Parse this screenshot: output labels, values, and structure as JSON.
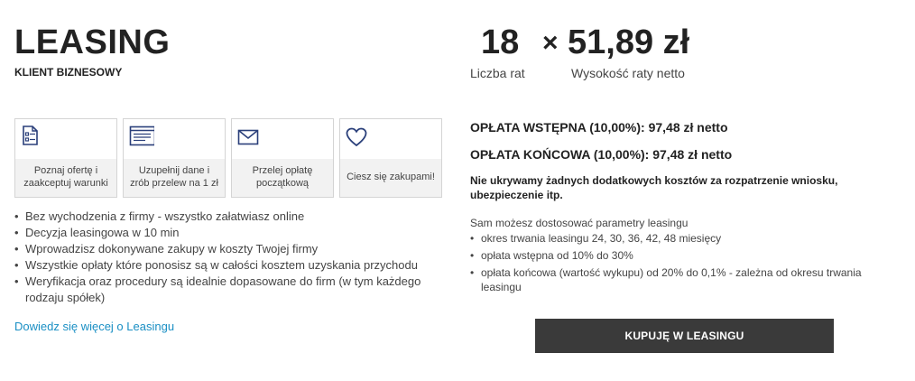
{
  "header": {
    "title": "LEASING",
    "subtitle": "KLIENT BIZNESOWY"
  },
  "steps": [
    {
      "icon": "document-list-icon",
      "label": "Poznaj ofertę i zaakceptuj warunki"
    },
    {
      "icon": "form-icon",
      "label": "Uzupełnij dane i zrób przelew na 1 zł"
    },
    {
      "icon": "envelope-icon",
      "label": "Przelej opłatę początkową"
    },
    {
      "icon": "heart-icon",
      "label": "Ciesz się zakupami!"
    }
  ],
  "benefits": [
    "Bez wychodzenia z firmy - wszystko załatwiasz online",
    "Decyzja leasingowa w 10 min",
    "Wprowadzisz dokonywane zakupy w koszty Twojej firmy",
    "Wszystkie opłaty które ponosisz są w całości kosztem uzyskania przychodu",
    "Weryfikacja oraz procedury są idealnie dopasowane do firm (w tym każdego rodzaju spółek)"
  ],
  "more_link": "Dowiedz się więcej o Leasingu",
  "installments": {
    "count": "18",
    "times": "×",
    "amount": "51,89 zł",
    "count_label": "Liczba rat",
    "amount_label": "Wysokość raty netto"
  },
  "fees": {
    "initial": "OPŁATA WSTĘPNA (10,00%): 97,48 zł netto",
    "final": "OPŁATA KOŃCOWA (10,00%): 97,48 zł netto"
  },
  "note": "Nie ukrywamy żadnych dodatkowych kosztów za rozpatrzenie wniosku, ubezpieczenie itp.",
  "params": {
    "intro": "Sam możesz dostosować parametry leasingu",
    "items": [
      "okres trwania leasingu 24, 30, 36, 42, 48 miesięcy",
      "opłata wstępna od 10% do 30%",
      "opłata końcowa (wartość wykupu) od 20% do 0,1% - zależna od okresu trwania leasingu"
    ]
  },
  "buy_button": "KUPUJĘ W LEASINGU",
  "colors": {
    "accent_link": "#1a8fc4",
    "icon": "#2a3f7a",
    "button_bg": "#3a3a3a"
  }
}
